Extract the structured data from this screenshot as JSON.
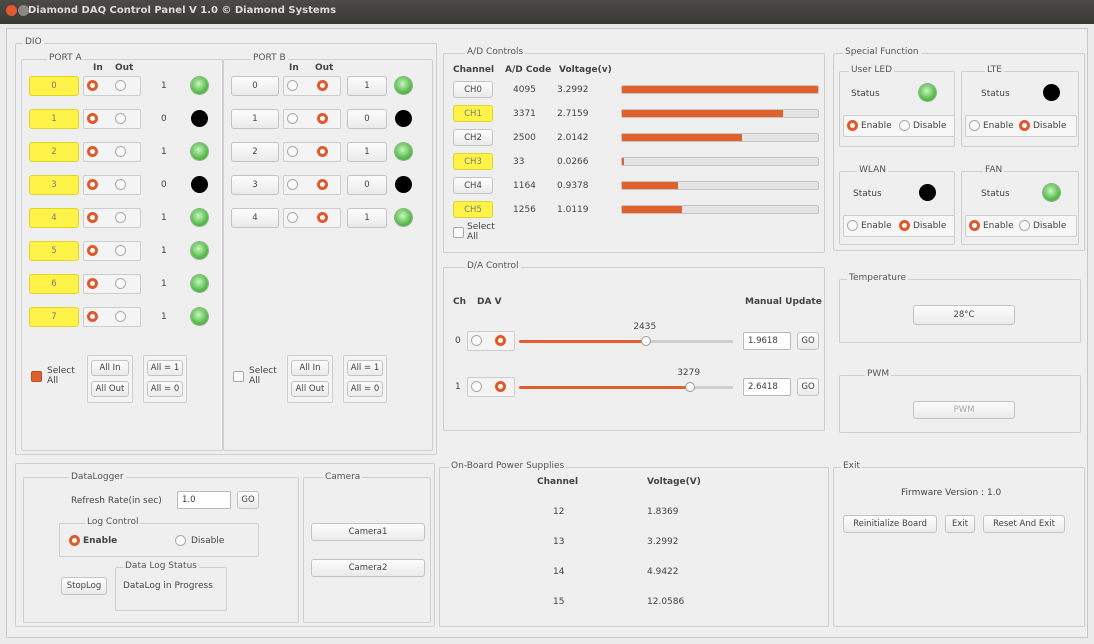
{
  "window": {
    "title": "Diamond DAQ Control Panel V 1.0 © Diamond Systems"
  },
  "dio": {
    "title": "DIO",
    "port_a": {
      "title": "PORT A",
      "in_label": "In",
      "out_label": "Out",
      "rows": [
        {
          "ch": "0",
          "value": "1",
          "led": "green"
        },
        {
          "ch": "1",
          "value": "0",
          "led": "black"
        },
        {
          "ch": "2",
          "value": "1",
          "led": "green"
        },
        {
          "ch": "3",
          "value": "0",
          "led": "black"
        },
        {
          "ch": "4",
          "value": "1",
          "led": "green"
        },
        {
          "ch": "5",
          "value": "1",
          "led": "green"
        },
        {
          "ch": "6",
          "value": "1",
          "led": "green"
        },
        {
          "ch": "7",
          "value": "1",
          "led": "green"
        }
      ],
      "select_all": "Select All",
      "all_in": "All In",
      "all_out": "All Out",
      "all_1": "All = 1",
      "all_0": "All = 0"
    },
    "port_b": {
      "title": "PORT B",
      "in_label": "In",
      "out_label": "Out",
      "rows": [
        {
          "ch": "0",
          "value": "1",
          "led": "green"
        },
        {
          "ch": "1",
          "value": "0",
          "led": "black"
        },
        {
          "ch": "2",
          "value": "1",
          "led": "green"
        },
        {
          "ch": "3",
          "value": "0",
          "led": "black"
        },
        {
          "ch": "4",
          "value": "1",
          "led": "green"
        }
      ],
      "select_all": "Select All",
      "all_in": "All In",
      "all_out": "All Out",
      "all_1": "All = 1",
      "all_0": "All = 0"
    }
  },
  "ad": {
    "title": "A/D Controls",
    "col_channel": "Channel",
    "col_code": "A/D Code",
    "col_voltage": "Voltage(v)",
    "rows": [
      {
        "ch": "CH0",
        "code": "4095",
        "voltage": "3.2992",
        "level": 1.0,
        "highlight": false
      },
      {
        "ch": "CH1",
        "code": "3371",
        "voltage": "2.7159",
        "level": 0.823,
        "highlight": true
      },
      {
        "ch": "CH2",
        "code": "2500",
        "voltage": "2.0142",
        "level": 0.61,
        "highlight": false
      },
      {
        "ch": "CH3",
        "code": "33",
        "voltage": "0.0266",
        "level": 0.008,
        "highlight": true
      },
      {
        "ch": "CH4",
        "code": "1164",
        "voltage": "0.9378",
        "level": 0.284,
        "highlight": false
      },
      {
        "ch": "CH5",
        "code": "1256",
        "voltage": "1.0119",
        "level": 0.307,
        "highlight": true
      }
    ],
    "select_all": "Select All"
  },
  "da": {
    "title": "D/A Control",
    "col_ch": "Ch",
    "col_da": "DA V",
    "col_manual": "Manual Update",
    "rows": [
      {
        "ch": "0",
        "slider_value": "2435",
        "level": 0.595,
        "input": "1.9618",
        "go": "GO"
      },
      {
        "ch": "1",
        "slider_value": "3279",
        "level": 0.8,
        "input": "2.6418",
        "go": "GO"
      }
    ]
  },
  "special": {
    "title": "Special Function",
    "user_led": {
      "title": "User LED",
      "status": "Status",
      "enable": "Enable",
      "disable": "Disable"
    },
    "lte": {
      "title": "LTE",
      "status": "Status",
      "enable": "Enable",
      "disable": "Disable"
    },
    "wlan": {
      "title": "WLAN",
      "status": "Status",
      "enable": "Enable",
      "disable": "Disable"
    },
    "fan": {
      "title": "FAN",
      "status": "Status",
      "enable": "Enable",
      "disable": "Disable"
    }
  },
  "temperature": {
    "title": "Temperature",
    "value": "28°C"
  },
  "pwm": {
    "title": "PWM",
    "button": "PWM"
  },
  "datalogger": {
    "title": "DataLogger",
    "refresh_label": "Refresh Rate(in sec)",
    "refresh_value": "1.0",
    "go": "GO",
    "log_control": "Log Control",
    "enable": "Enable",
    "disable": "Disable",
    "status_title": "Data Log Status",
    "status_text": "DataLog in Progress",
    "stop": "StopLog"
  },
  "camera": {
    "title": "Camera",
    "cam1": "Camera1",
    "cam2": "Camera2"
  },
  "power": {
    "title": "On-Board Power Supplies",
    "col_channel": "Channel",
    "col_voltage": "Voltage(V)",
    "rows": [
      {
        "ch": "12",
        "v": "1.8369"
      },
      {
        "ch": "13",
        "v": "3.2992"
      },
      {
        "ch": "14",
        "v": "4.9422"
      },
      {
        "ch": "15",
        "v": "12.0586"
      }
    ]
  },
  "exit": {
    "title": "Exit",
    "firmware": "Firmware Version : 1.0",
    "reinit": "Reinitialize Board",
    "exit": "Exit",
    "reset_exit": "Reset And Exit"
  },
  "colors": {
    "accent": "#e0602e",
    "highlight": "#fff34a",
    "led_on": "#58bd4c",
    "led_off": "#000000"
  }
}
